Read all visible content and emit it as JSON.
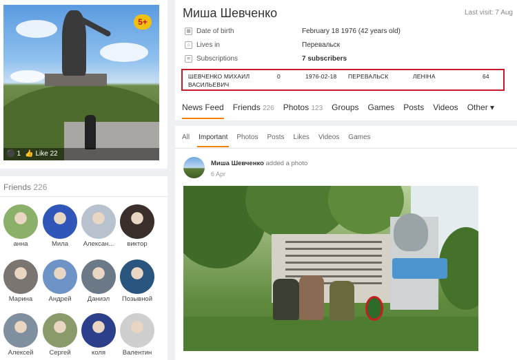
{
  "profile": {
    "name": "Миша Шевченко",
    "last_visit": "Last visit: 7 Aug",
    "badge": "5+",
    "photo_comments": "1",
    "photo_likes": "Like 22",
    "info": [
      {
        "label": "Date of birth",
        "value": "February 18 1976 (42 years old)",
        "icon": "calendar-icon",
        "bold": false
      },
      {
        "label": "Lives in",
        "value": "Перевальск",
        "icon": "location-icon",
        "bold": false
      },
      {
        "label": "Subscriptions",
        "value": "7 subscribers",
        "icon": "rss-icon",
        "bold": true
      }
    ],
    "record": {
      "surname_name": "ШЕВЧЕНКО МИХАИЛ",
      "patronymic": "ВАСИЛЬЕВИЧ",
      "zero": "0",
      "date": "1976-02-18",
      "city": "ПЕРЕВАЛЬСК",
      "street": "ЛЕНІНА",
      "house": "64"
    }
  },
  "tabs": [
    {
      "label": "News Feed",
      "count": ""
    },
    {
      "label": "Friends",
      "count": "226"
    },
    {
      "label": "Photos",
      "count": "123"
    },
    {
      "label": "Groups",
      "count": ""
    },
    {
      "label": "Games",
      "count": ""
    },
    {
      "label": "Posts",
      "count": ""
    },
    {
      "label": "Videos",
      "count": ""
    },
    {
      "label": "Other ▾",
      "count": ""
    }
  ],
  "subtabs": [
    "All",
    "Important",
    "Photos",
    "Posts",
    "Likes",
    "Videos",
    "Games"
  ],
  "post": {
    "author": "Миша Шевченко",
    "action": "added a photo",
    "date": "6 Apr"
  },
  "friends": {
    "title": "Friends",
    "count": "226",
    "items": [
      {
        "name": "анна",
        "color": "#8bb06a"
      },
      {
        "name": "Мила",
        "color": "#2f56b8"
      },
      {
        "name": "Алексан...",
        "color": "#b8c2cf"
      },
      {
        "name": "виктор",
        "color": "#3a2f2a"
      },
      {
        "name": "Марина",
        "color": "#7a7570"
      },
      {
        "name": "Андрей",
        "color": "#6e93c7"
      },
      {
        "name": "Даниэл",
        "color": "#6b7a86"
      },
      {
        "name": "Позывной",
        "color": "#29557f"
      },
      {
        "name": "Алексей",
        "color": "#7f8f9e"
      },
      {
        "name": "Сергей",
        "color": "#8a9a6a"
      },
      {
        "name": "коля",
        "color": "#2c3f8a"
      },
      {
        "name": "Валентин",
        "color": "#cfcfcf"
      }
    ]
  }
}
